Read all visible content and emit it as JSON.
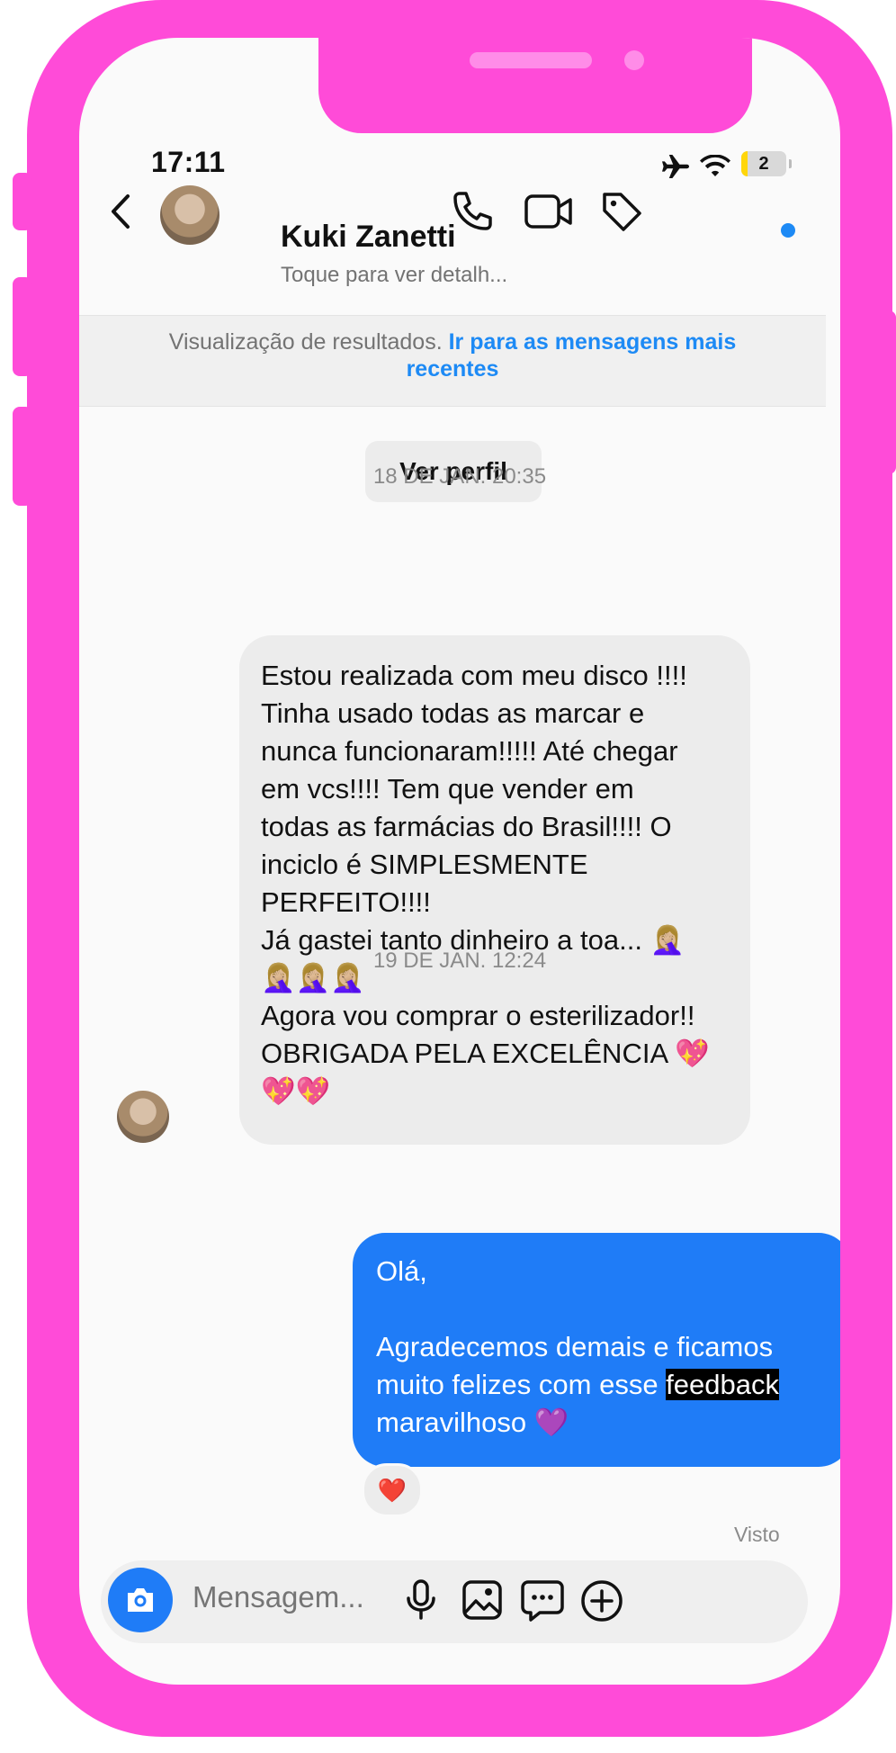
{
  "status": {
    "time": "17:11",
    "battery": "2"
  },
  "header": {
    "name": "Kuki Zanetti",
    "subtitle": "Toque para ver detalh..."
  },
  "banner": {
    "text": "Visualização de resultados.",
    "link": "Ir para as mensagens mais recentes"
  },
  "profile_button": "Ver perfil",
  "messages": [
    {
      "date": "18 DE JAN. 20:35",
      "direction": "incoming",
      "lines": [
        "Estou realizada com meu disco !!!!",
        "Tinha usado todas as marcar e",
        "nunca funcionaram!!!!! Até chegar",
        "em vcs!!!! Tem que vender em",
        "todas as farmácias do Brasil!!!! O",
        "inciclo é SIMPLESMENTE",
        "PERFEITO!!!!",
        "Já gastei tanto dinheiro a toa... 🤦🏼‍♀️",
        "🤦🏼‍♀️🤦🏼‍♀️🤦🏼‍♀️",
        "Agora vou comprar o esterilizador!!",
        "OBRIGADA PELA EXCELÊNCIA 💖",
        "💖💖"
      ]
    },
    {
      "date": "19 DE JAN. 12:24",
      "direction": "outgoing",
      "greeting": "Olá,",
      "body_before": "Agradecemos demais e ficamos muito felizes com esse ",
      "highlight": "feedback",
      "body_after": "maravilhoso 💜",
      "reaction": "❤️"
    }
  ],
  "seen": "Visto",
  "composer": {
    "placeholder": "Mensagem..."
  },
  "colors": {
    "frame": "#ff4bd8",
    "accent": "#1d8af5",
    "outgoing_bubble": "#1f7cf7"
  },
  "icons": [
    "back-arrow-icon",
    "phone-icon",
    "video-icon",
    "tag-icon",
    "camera-icon",
    "microphone-icon",
    "gallery-icon",
    "sticker-icon",
    "plus-icon",
    "airplane-icon",
    "wifi-icon",
    "battery-icon"
  ]
}
